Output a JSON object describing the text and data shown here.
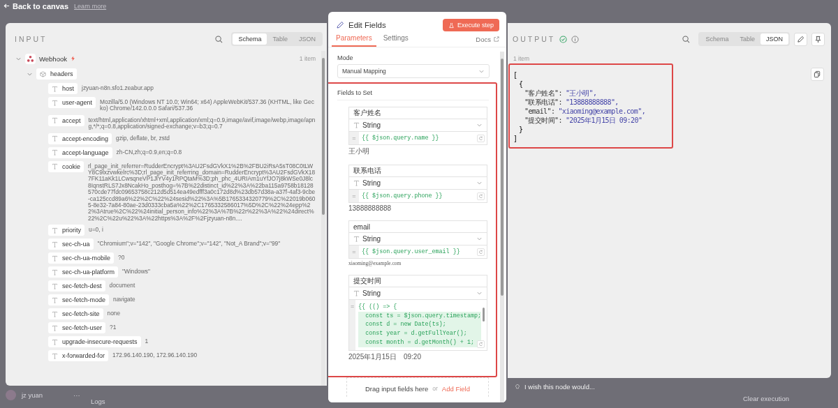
{
  "top_bar": {
    "back": "Back to canvas",
    "behind_link": "Learn more"
  },
  "input_panel": {
    "title": "INPUT",
    "tabs": [
      {
        "label": "Schema",
        "selected": true
      },
      {
        "label": "Table",
        "selected": false
      },
      {
        "label": "JSON",
        "selected": false
      }
    ],
    "node": {
      "name": "Webhook",
      "count": "1 item",
      "expanded": true
    },
    "group": {
      "name": "headers",
      "expanded": true
    },
    "fields": [
      {
        "key": "host",
        "value": "jzyuan-n8n.sfo1.zeabur.app"
      },
      {
        "key": "user-agent",
        "value": "Mozilla/5.0 (Windows NT 10.0; Win64; x64) AppleWebKit/537.36 (KHTML, like Gecko) Chrome/142.0.0.0 Safari/537.36"
      },
      {
        "key": "accept",
        "value": "text/html,application/xhtml+xml,application/xml;q=0.9,image/avif,image/webp,image/apng,*/*;q=0.8,application/signed-exchange;v=b3;q=0.7"
      },
      {
        "key": "accept-encoding",
        "value": "gzip, deflate, br, zstd"
      },
      {
        "key": "accept-language",
        "value": "zh-CN,zh;q=0.9,en;q=0.8"
      },
      {
        "key": "cookie",
        "value": "rl_page_init_referrer=RudderEncrypt%3AU2FsdGVkX1%2B%2FBU2iRsA5sT08C0tLWY8C9lxzvwkelrc%3D;rl_page_init_referring_domain=RudderEncrypt%3AU2FsdGVkX187FK11aKk1LCwsqneVP1JlYV4y1RPQtaM%3D;ph_phc_4URIAm1uYfJO7j8kWSe0J8lc8IqnstRLS7Jx8NcakHo_posthog=%7B%22distinct_id%22%3A%22ba115a9758b18128570cde77fdc09653758c212d5d514ea49edfff3a0c172d8d%23db57d38a-a37f-4af3-9cbe-ca125ccd89a6%22%2C%22%24sesid%22%3A%5B1765334320779%2C%22019b0605-8e32-7a84-80ae-23d0333cba5a%22%2C1765332586017%5D%2C%22%24epp%22%3Atrue%2C%22%24initial_person_info%22%3A%7B%22r%22%3A%22%24direct%22%2C%22u%22%3A%22https%3A%2F%2Fjzyuan-n8n...."
      },
      {
        "key": "priority",
        "value": "u=0, i"
      },
      {
        "key": "sec-ch-ua",
        "value": "\"Chromium\";v=\"142\", \"Google Chrome\";v=\"142\", \"Not_A Brand\";v=\"99\""
      },
      {
        "key": "sec-ch-ua-mobile",
        "value": "?0"
      },
      {
        "key": "sec-ch-ua-platform",
        "value": "\"Windows\""
      },
      {
        "key": "sec-fetch-dest",
        "value": "document"
      },
      {
        "key": "sec-fetch-mode",
        "value": "navigate"
      },
      {
        "key": "sec-fetch-site",
        "value": "none"
      },
      {
        "key": "sec-fetch-user",
        "value": "?1"
      },
      {
        "key": "upgrade-insecure-requests",
        "value": "1"
      },
      {
        "key": "x-forwarded-for",
        "value": "172.96.140.190, 172.96.140.190"
      }
    ]
  },
  "editor": {
    "title": "Edit Fields",
    "execute": "Execute step",
    "tabs": [
      {
        "label": "Parameters",
        "selected": true
      },
      {
        "label": "Settings",
        "selected": false
      }
    ],
    "docs": "Docs",
    "mode_label": "Mode",
    "mode": "Manual Mapping",
    "fields_label": "Fields to Set",
    "highlighted": true,
    "assignments": [
      {
        "name": "客户姓名",
        "type": "String",
        "operator": "=",
        "code": [
          "{{ $json.query.name }}"
        ],
        "result": "王小明",
        "kind": "text"
      },
      {
        "name": "联系电话",
        "type": "String",
        "operator": "=",
        "code": [
          "{{ $json.query.phone }}"
        ],
        "result": "13888888888",
        "kind": "text"
      },
      {
        "name": "email",
        "type": "String",
        "operator": "=",
        "code": [
          "{{ $json.query.user_email }}"
        ],
        "result": "xiaoming@example.com",
        "kind": "mono"
      },
      {
        "name": "提交时间",
        "type": "String",
        "operator": "=",
        "code": [
          "{{ (() => {",
          "  const ts = $json.query.timestamp;",
          "  const d = new Date(ts);",
          "  const year = d.getFullYear();",
          "  const month = d.getMonth() + 1;"
        ],
        "result": "2025年1月15日　09:20",
        "kind": "text"
      }
    ],
    "drop_hint": "Drag input fields here",
    "or": "or",
    "add_field": "Add Field"
  },
  "output_panel": {
    "title": "OUTPUT",
    "tabs": [
      {
        "label": "Schema",
        "selected": false
      },
      {
        "label": "Table",
        "selected": false
      },
      {
        "label": "JSON",
        "selected": true
      }
    ],
    "count": "1 item",
    "highlighted": true,
    "json": [
      {
        "kind": "outer",
        "text": "["
      },
      {
        "kind": "inner",
        "text": "{"
      },
      {
        "kind": "entry",
        "key": "\"客户姓名\":",
        "value": "\"王小明\","
      },
      {
        "kind": "entry",
        "key": "\"联系电话\":",
        "value": "\"13888888888\","
      },
      {
        "kind": "entry",
        "key": "\"email\":",
        "value": "\"xiaoming@example.com\","
      },
      {
        "kind": "entry",
        "key": "\"提交时间\":",
        "value": "\"2025年1月15日 09:20\""
      },
      {
        "kind": "inner",
        "text": "}"
      },
      {
        "kind": "outer",
        "text": "]"
      }
    ]
  },
  "feedback": "I wish this node would...",
  "bottom_bar": {
    "user": "jz yuan",
    "more": "···",
    "logs": "Logs",
    "clear": "Clear execution"
  }
}
